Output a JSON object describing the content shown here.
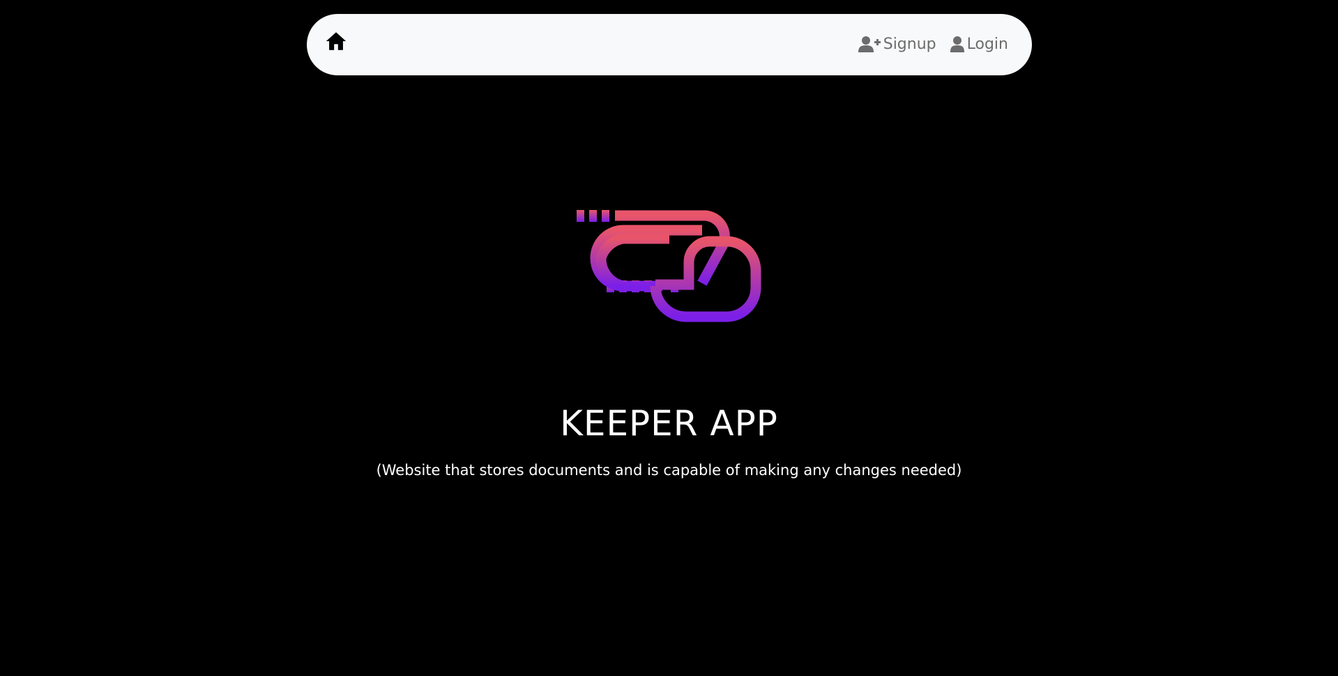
{
  "navbar": {
    "home_icon": "home-icon",
    "signup": {
      "icon": "user-plus-icon",
      "label": "Signup"
    },
    "login": {
      "icon": "user-icon",
      "label": "Login"
    }
  },
  "logo": {
    "gradient_top": "#e8556a",
    "gradient_bottom": "#7b1fe8"
  },
  "hero": {
    "title": "KEEPER APP",
    "subtitle": "(Website that stores documents and is capable of making any changes needed)"
  },
  "colors": {
    "background": "#000000",
    "navbar_bg": "#f8f9fa",
    "nav_text": "#6c6c6c",
    "text": "#ffffff"
  }
}
